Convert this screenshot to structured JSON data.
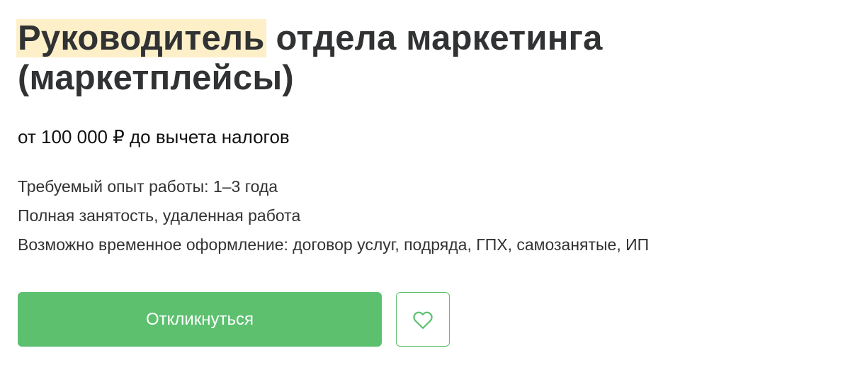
{
  "vacancy": {
    "title_highlight": "Руководитель",
    "title_rest": " отдела маркетинга (маркетплейсы)",
    "salary": "от 100 000 ₽ до вычета налогов",
    "details": [
      "Требуемый опыт работы: 1–3 года",
      "Полная занятость, удаленная работа",
      "Возможно временное оформление: договор услуг, подряда, ГПХ, самозанятые, ИП"
    ]
  },
  "actions": {
    "respond_label": "Откликнуться",
    "favorite_icon": "heart-outline-icon"
  },
  "colors": {
    "accent_green": "#5cc06f",
    "highlight": "#fdefc8",
    "title_text": "#303233"
  }
}
